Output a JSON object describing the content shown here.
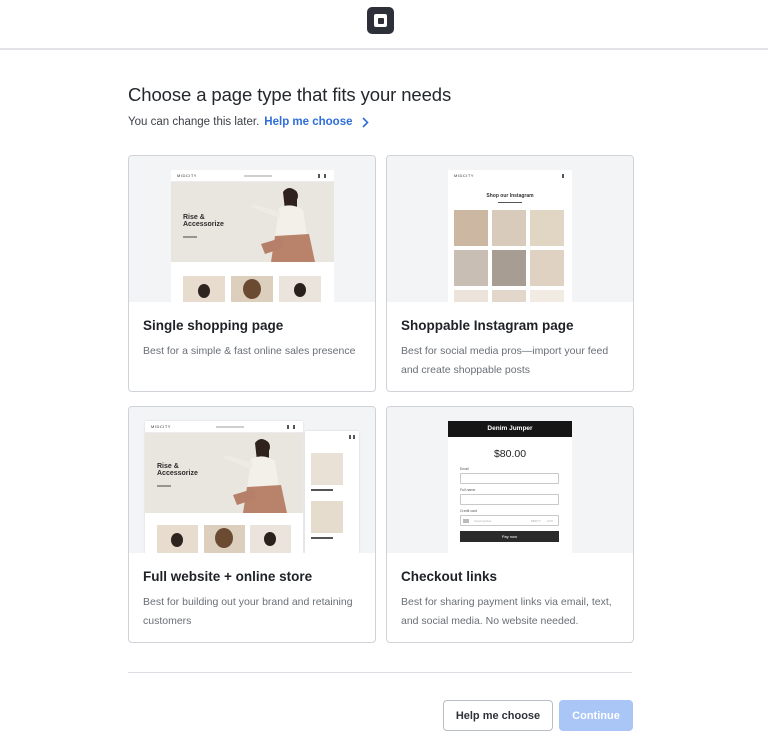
{
  "header": {
    "logo_icon": "square-logo-icon"
  },
  "page": {
    "title": "Choose a page type that fits your needs",
    "subtitle": "You can change this later.",
    "help_link": "Help me choose"
  },
  "cards": [
    {
      "title": "Single shopping page",
      "description": "Best for a simple & fast online sales presence",
      "preview": {
        "brand": "MIDCITY",
        "headline_1": "Rise &",
        "headline_2": "Accessorize"
      }
    },
    {
      "title": "Shoppable Instagram page",
      "description": "Best for social media pros—import your feed and create shoppable posts",
      "preview": {
        "brand": "MIDCITY",
        "heading": "Shop our Instagram"
      }
    },
    {
      "title": "Full website + online store",
      "description": "Best for building out your brand and retaining customers",
      "preview": {
        "brand": "MIDCITY",
        "headline_1": "Rise &",
        "headline_2": "Accessorize"
      }
    },
    {
      "title": "Checkout links",
      "description": "Best for sharing payment links via email, text, and social media. No website needed.",
      "preview": {
        "product": "Denim Jumper",
        "price": "$80.00",
        "email_label": "Email",
        "name_label": "Full name",
        "card_label": "Credit card",
        "card_placeholder": "Card number",
        "card_expiry": "MM/YY",
        "card_cvv": "CVV",
        "pay_label": "Pay now"
      }
    }
  ],
  "footer": {
    "secondary_button": "Help me choose",
    "primary_button": "Continue"
  },
  "colors": {
    "link": "#2f6ed8",
    "primary_disabled": "#a9c6f6",
    "logo": "#2d3038"
  }
}
